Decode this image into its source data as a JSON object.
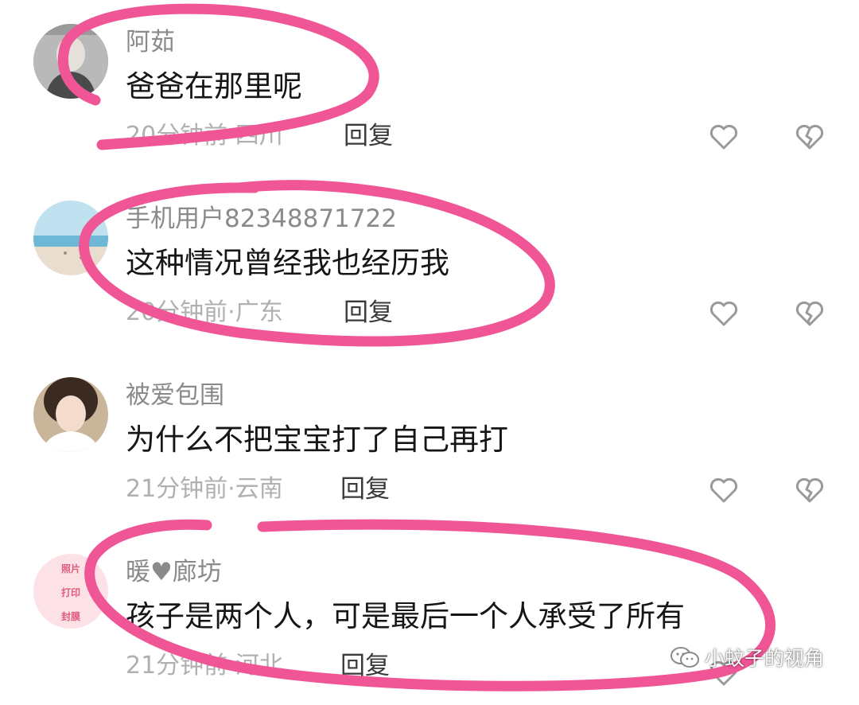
{
  "comments": [
    {
      "username": "阿茹",
      "text": "爸爸在那里呢",
      "meta": "20分钟前·四川",
      "reply": "回复",
      "avatar": "avatar-photo-person"
    },
    {
      "username": "手机用户82348871722",
      "text": "这种情况曾经我也经历我",
      "meta": "20分钟前·广东",
      "reply": "回复",
      "avatar": "avatar-photo-beach"
    },
    {
      "username": "被爱包围",
      "text": "为什么不把宝宝打了自己再打",
      "meta": "21分钟前·云南",
      "reply": "回复",
      "avatar": "avatar-photo-woman"
    },
    {
      "username": "暖♥廊坊",
      "text": "孩子是两个人，可是最后一个人承受了所有",
      "meta": "21分钟前·河北",
      "reply": "回复",
      "avatar": "avatar-shop-badge",
      "avatar_lines": [
        "照片",
        "打印",
        "封膜"
      ]
    }
  ],
  "icons": {
    "like": "heart-outline-icon",
    "dislike": "broken-heart-icon"
  },
  "watermark": {
    "text": "小蚊子的视角",
    "icon": "wechat-icon"
  },
  "colors": {
    "highlight": "#f05596",
    "username": "#8a8a8a",
    "text": "#161616",
    "meta": "#b0b0b0",
    "icon": "#9a9a9a"
  }
}
